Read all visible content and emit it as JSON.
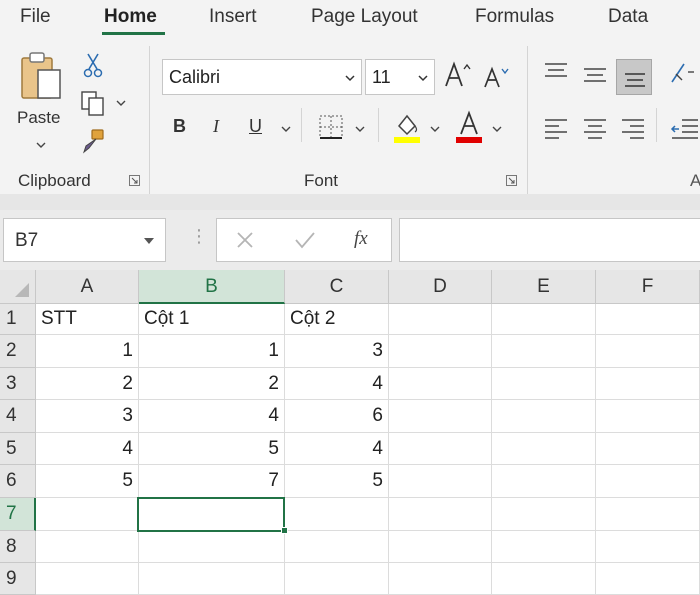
{
  "tabs": [
    {
      "label": "File",
      "active": false
    },
    {
      "label": "Home",
      "active": true
    },
    {
      "label": "Insert",
      "active": false
    },
    {
      "label": "Page Layout",
      "active": false
    },
    {
      "label": "Formulas",
      "active": false
    },
    {
      "label": "Data",
      "active": false
    }
  ],
  "ribbon": {
    "clipboard": {
      "label": "Clipboard",
      "paste_label": "Paste"
    },
    "font": {
      "label": "Font",
      "font_name": "Calibri",
      "font_size": "11",
      "bold": "B",
      "italic": "I",
      "underline": "U"
    },
    "alignment_partial_label": "A"
  },
  "formula_bar": {
    "name_box": "B7",
    "fx": "fx",
    "value": ""
  },
  "colors": {
    "accent": "#217346",
    "highlight": "#ffff00",
    "font_color": "#ff0000"
  },
  "sheet": {
    "columns": [
      "A",
      "B",
      "C",
      "D",
      "E",
      "F"
    ],
    "rows": [
      "1",
      "2",
      "3",
      "4",
      "5",
      "6",
      "7",
      "8",
      "9"
    ],
    "selected_cell": "B7",
    "cells": [
      [
        "STT",
        "Cột 1",
        "Cột 2",
        "",
        "",
        ""
      ],
      [
        "1",
        "1",
        "3",
        "",
        "",
        ""
      ],
      [
        "2",
        "2",
        "4",
        "",
        "",
        ""
      ],
      [
        "3",
        "4",
        "6",
        "",
        "",
        ""
      ],
      [
        "4",
        "5",
        "4",
        "",
        "",
        ""
      ],
      [
        "5",
        "7",
        "5",
        "",
        "",
        ""
      ],
      [
        "",
        "",
        "",
        "",
        "",
        ""
      ],
      [
        "",
        "",
        "",
        "",
        "",
        ""
      ],
      [
        "",
        "",
        "",
        "",
        "",
        ""
      ]
    ]
  }
}
